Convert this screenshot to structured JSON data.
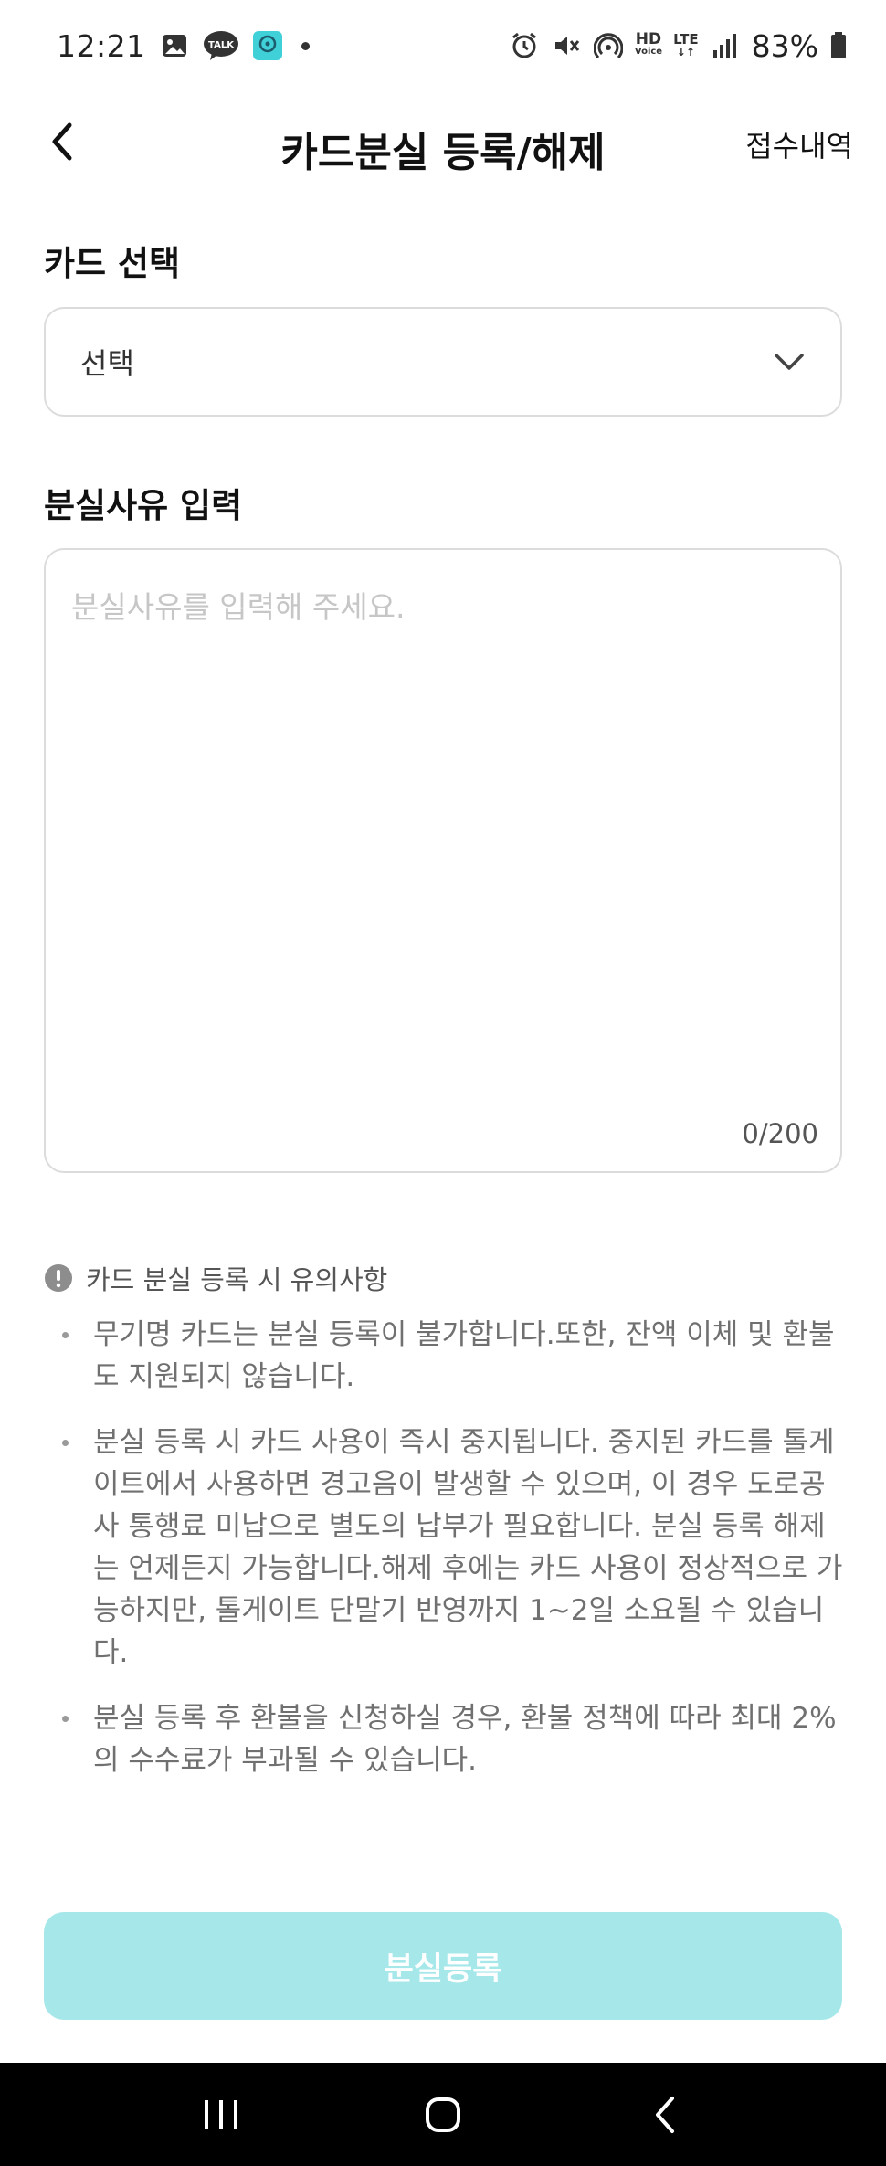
{
  "status_bar": {
    "time": "12:21",
    "battery": "83%",
    "icons": [
      "image-icon",
      "talk-icon",
      "app-icon",
      "alarm-icon",
      "mute-icon",
      "hotspot-icon",
      "hd-voice-icon",
      "lte-icon",
      "signal-icon",
      "battery-icon"
    ],
    "hd_label": "HD",
    "voice_label": "Voice",
    "lte_label": "LTE",
    "talk_label": "TALK"
  },
  "header": {
    "title": "카드분실 등록/해제",
    "history_link": "접수내역"
  },
  "card_select": {
    "label": "카드 선택",
    "value": "선택"
  },
  "reason": {
    "label": "분실사유 입력",
    "placeholder": "분실사유를 입력해 주세요.",
    "counter": "0/200"
  },
  "notice": {
    "title": "카드 분실 등록 시 유의사항",
    "items": [
      "무기명 카드는 분실 등록이 불가합니다.또한, 잔액 이체 및 환불도 지원되지 않습니다.",
      "분실 등록 시 카드 사용이 즉시 중지됩니다. 중지된 카드를 톨게이트에서 사용하면 경고음이 발생할 수 있으며, 이 경우 도로공사 통행료 미납으로 별도의 납부가 필요합니다. 분실 등록 해제는 언제든지 가능합니다.해제 후에는 카드 사용이 정상적으로 가능하지만, 톨게이트 단말기 반영까지 1~2일 소요될 수 있습니다.",
      "분실 등록 후 환불을 신청하실 경우, 환불 정책에 따라 최대 2%의 수수료가 부과될 수 있습니다."
    ]
  },
  "submit_button": {
    "label": "분실등록",
    "color": "#a6e7ea"
  },
  "nav_bar": {
    "icons": [
      "recent-apps-icon",
      "home-icon",
      "back-icon"
    ]
  }
}
